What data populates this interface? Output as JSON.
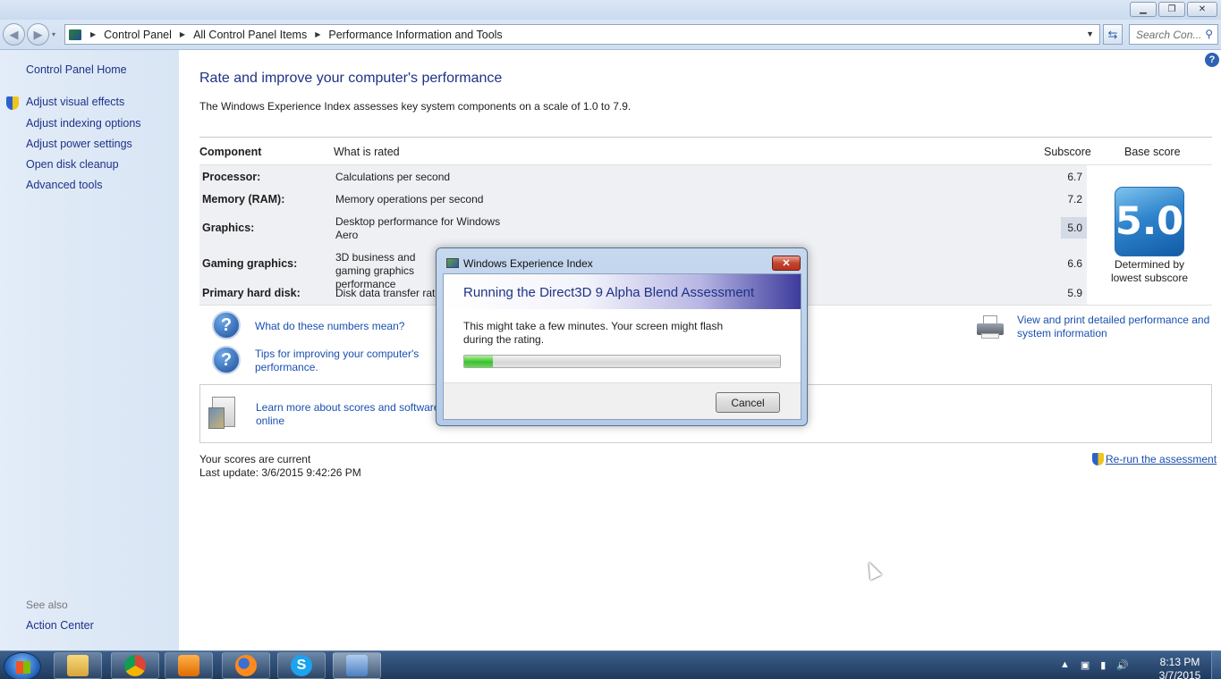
{
  "window": {
    "controls": {
      "minimize": "▁",
      "maximize": "❐",
      "close": "✕"
    }
  },
  "nav": {
    "back": "◀",
    "forward": "▶",
    "dropdown": "▾",
    "breadcrumbs": [
      "Control Panel",
      "All Control Panel Items",
      "Performance Information and Tools"
    ],
    "separator": "▶",
    "address_dropdown": "▼",
    "refresh": "⇆",
    "search_placeholder": "Search Con...",
    "search_icon": "⚲"
  },
  "sidebar": {
    "home": "Control Panel Home",
    "items": [
      "Adjust visual effects",
      "Adjust indexing options",
      "Adjust power settings",
      "Open disk cleanup",
      "Advanced tools"
    ],
    "see_also_label": "See also",
    "see_also_items": [
      "Action Center"
    ]
  },
  "help_icon": "?",
  "main": {
    "title": "Rate and improve your computer's performance",
    "description": "The Windows Experience Index assesses key system components on a scale of 1.0 to 7.9.",
    "headers": {
      "component": "Component",
      "rated": "What is rated",
      "subscore": "Subscore",
      "base": "Base score"
    },
    "rows": [
      {
        "component": "Processor:",
        "rated": "Calculations per second",
        "subscore": "6.7"
      },
      {
        "component": "Memory (RAM):",
        "rated": "Memory operations per second",
        "subscore": "7.2"
      },
      {
        "component": "Graphics:",
        "rated": "Desktop performance for Windows Aero",
        "subscore": "5.0"
      },
      {
        "component": "Gaming graphics:",
        "rated": "3D business and gaming graphics performance",
        "subscore": "6.6"
      },
      {
        "component": "Primary hard disk:",
        "rated": "Disk data transfer rate",
        "subscore": "5.9"
      }
    ],
    "base_score": "5.0",
    "base_caption": "Determined by lowest subscore",
    "links": {
      "numbers": "What do these numbers mean?",
      "tips": "Tips for improving your computer's performance.",
      "print": "View and print detailed performance and system information",
      "learn": "Learn more about scores and software online"
    },
    "status_current": "Your scores are current",
    "last_update": "Last update: 3/6/2015 9:42:26 PM",
    "rerun": "Re-run the assessment"
  },
  "dialog": {
    "title": "Windows Experience Index",
    "close": "✕",
    "heading": "Running the Direct3D 9 Alpha Blend Assessment",
    "message": "This might take a few minutes. Your screen might flash during the rating.",
    "progress": 0.09,
    "cancel": "Cancel"
  },
  "taskbar": {
    "items": [
      "explorer",
      "chrome",
      "media-player",
      "firefox",
      "skype",
      "control-panel"
    ],
    "tray_icons": [
      "▲",
      "▣",
      "▮",
      "🔊"
    ],
    "time": "8:13 PM",
    "date": "3/7/2015"
  },
  "colors": {
    "link": "#1a4fb0",
    "title_blue": "#1e3287",
    "sidebar_bg": "#dfe9f6",
    "progress_green": "#3dc12f"
  }
}
